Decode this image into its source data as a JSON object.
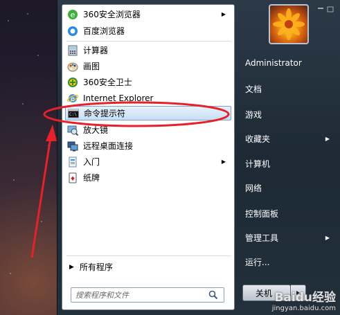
{
  "programs": [
    {
      "label": "360安全浏览器",
      "icon": "360-browser-icon",
      "has_arrow": true
    },
    {
      "label": "百度浏览器",
      "icon": "baidu-browser-icon",
      "has_arrow": false
    },
    {
      "label": "计算器",
      "icon": "calculator-icon",
      "has_arrow": false
    },
    {
      "label": "画图",
      "icon": "paint-icon",
      "has_arrow": false
    },
    {
      "label": "360安全卫士",
      "icon": "360-safe-icon",
      "has_arrow": false
    },
    {
      "label": "Internet Explorer",
      "icon": "ie-icon",
      "has_arrow": false
    },
    {
      "label": "命令提示符",
      "icon": "cmd-icon",
      "has_arrow": false
    },
    {
      "label": "放大镜",
      "icon": "magnifier-icon",
      "has_arrow": false
    },
    {
      "label": "远程桌面连接",
      "icon": "remote-desktop-icon",
      "has_arrow": false
    },
    {
      "label": "入门",
      "icon": "getting-started-icon",
      "has_arrow": true
    },
    {
      "label": "纸牌",
      "icon": "solitaire-icon",
      "has_arrow": false
    }
  ],
  "all_programs": "所有程序",
  "search": {
    "placeholder": "搜索程序和文件"
  },
  "right": [
    {
      "label": "Administrator",
      "has_arrow": false
    },
    {
      "label": "文档",
      "has_arrow": false
    },
    {
      "label": "游戏",
      "has_arrow": false
    },
    {
      "label": "收藏夹",
      "has_arrow": true
    },
    {
      "label": "计算机",
      "has_arrow": false
    },
    {
      "label": "网络",
      "has_arrow": false
    },
    {
      "label": "控制面板",
      "has_arrow": false
    },
    {
      "label": "管理工具",
      "has_arrow": true
    },
    {
      "label": "运行...",
      "has_arrow": false
    }
  ],
  "shutdown_label": "关机",
  "watermark": {
    "brand": "Baidu经验",
    "url": "jingyan.baidu.com"
  },
  "colors": {
    "highlight_annotation": "#e8202a",
    "selection": "#c7dff5"
  }
}
